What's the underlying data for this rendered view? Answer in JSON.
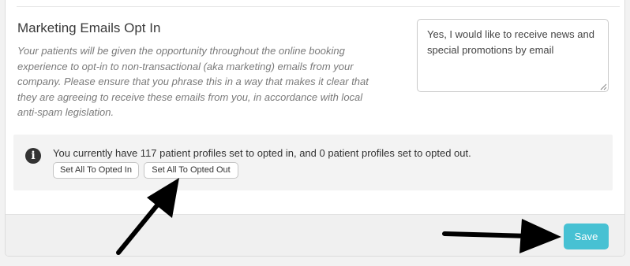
{
  "section": {
    "title": "Marketing Emails Opt In",
    "help_text": "Your patients will be given the opportunity throughout the online booking experience to opt-in to non-transactional (aka marketing) emails from your company. Please ensure that you phrase this in a way that makes it clear that they are agreeing to receive these emails from you, in accordance with local anti-spam legislation."
  },
  "optin_text": {
    "value": "Yes, I would like to receive news and special promotions by email"
  },
  "info": {
    "message": "You currently have 117 patient profiles set to opted in, and 0 patient profiles set to opted out.",
    "opted_in_count": 117,
    "opted_out_count": 0,
    "set_all_in_label": "Set All To Opted In",
    "set_all_out_label": "Set All To Opted Out"
  },
  "footer": {
    "save_label": "Save"
  },
  "colors": {
    "accent": "#47c1d3",
    "annotation_arrow": "#000000"
  },
  "icons": {
    "info": "info-icon",
    "resize": "resize-grip-icon"
  }
}
